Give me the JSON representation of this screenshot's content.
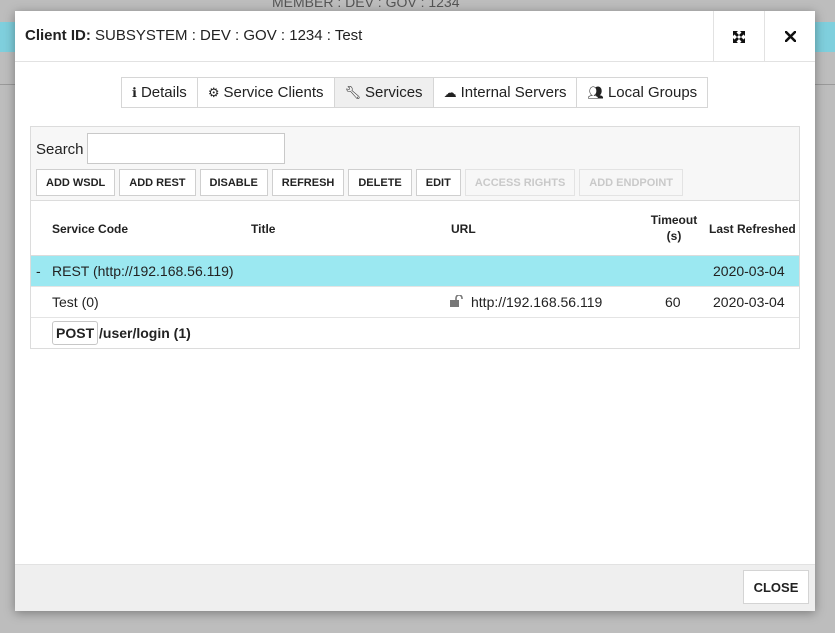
{
  "background": {
    "title": "MEMBER : DEV : GOV : 1234"
  },
  "dialog": {
    "title_label": "Client ID:",
    "title_value": "SUBSYSTEM : DEV : GOV : 1234 : Test",
    "maximize_icon": "expand-icon",
    "close_icon": "close-icon"
  },
  "tabs": [
    {
      "label": "Details",
      "icon": "info-icon"
    },
    {
      "label": "Service Clients",
      "icon": "gears-icon"
    },
    {
      "label": "Services",
      "icon": "wrench-icon",
      "active": true
    },
    {
      "label": "Internal Servers",
      "icon": "cloud-icon"
    },
    {
      "label": "Local Groups",
      "icon": "users-icon"
    }
  ],
  "toolbar": {
    "search_label": "Search",
    "search_value": "",
    "buttons": [
      {
        "label": "ADD WSDL",
        "enabled": true
      },
      {
        "label": "ADD REST",
        "enabled": true
      },
      {
        "label": "DISABLE",
        "enabled": true
      },
      {
        "label": "REFRESH",
        "enabled": true
      },
      {
        "label": "DELETE",
        "enabled": true
      },
      {
        "label": "EDIT",
        "enabled": true
      },
      {
        "label": "ACCESS RIGHTS",
        "enabled": false
      },
      {
        "label": "ADD ENDPOINT",
        "enabled": false
      }
    ]
  },
  "table": {
    "headers": {
      "service_code": "Service Code",
      "title": "Title",
      "url": "URL",
      "timeout_line1": "Timeout",
      "timeout_line2": "(s)",
      "last_refreshed": "Last Refreshed"
    },
    "rest_row": {
      "toggle": "-",
      "name": "REST (http://192.168.56.119)",
      "last_refreshed": "2020-03-04",
      "highlight_color": "#9be8f1"
    },
    "service_row": {
      "code": "Test (0)",
      "url": "http://192.168.56.119",
      "timeout": "60",
      "last_refreshed": "2020-03-04",
      "url_icon": "unlock-icon"
    },
    "endpoint_row": {
      "method": "POST",
      "path": "/user/login (1)"
    }
  },
  "footer": {
    "close_label": "CLOSE"
  }
}
